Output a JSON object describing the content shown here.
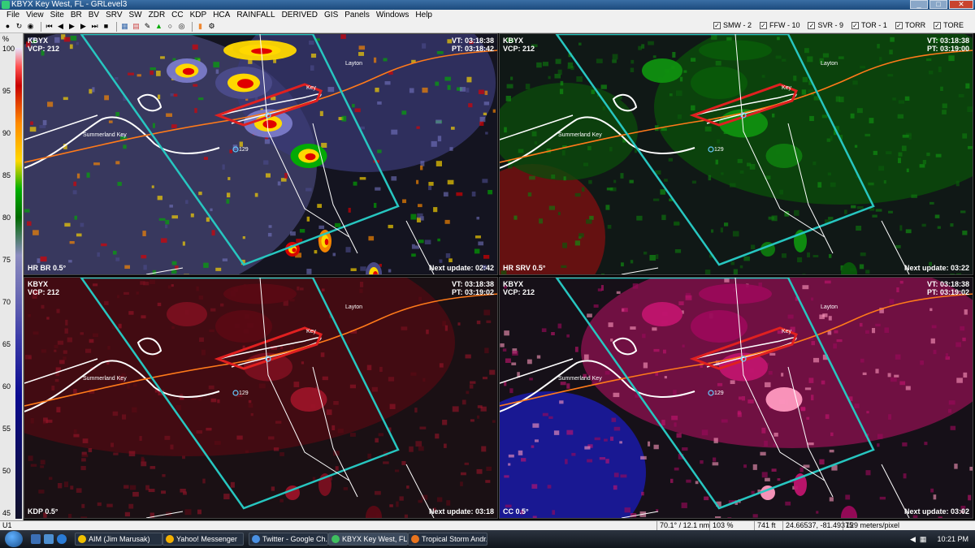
{
  "window": {
    "title": "KBYX Key West, FL - GRLevel3"
  },
  "menu": [
    "File",
    "View",
    "Site",
    "BR",
    "BV",
    "SRV",
    "SW",
    "ZDR",
    "CC",
    "KDP",
    "HCA",
    "RAINFALL",
    "DERIVED",
    "GIS",
    "Panels",
    "Windows",
    "Help"
  ],
  "toolbar": {
    "nav_icons": [
      "stop-icon",
      "refresh-icon",
      "loop-icon",
      "first-frame-icon",
      "prev-frame-icon",
      "play-icon",
      "next-frame-icon",
      "last-frame-icon",
      "pause-icon",
      "grid-icon",
      "palette-icon",
      "ruler-icon",
      "warning-icon",
      "circle-icon",
      "center-icon",
      "panel-icon",
      "settings-icon"
    ],
    "warning_toggles": [
      {
        "label": "SMW - 2",
        "checked": true
      },
      {
        "label": "FFW - 10",
        "checked": true
      },
      {
        "label": "SVR - 9",
        "checked": true
      },
      {
        "label": "TOR - 1",
        "checked": true
      },
      {
        "label": "TORR",
        "checked": true
      },
      {
        "label": "TORE",
        "checked": true
      }
    ]
  },
  "legend": {
    "unit": "%",
    "ticks": [
      "100",
      "95",
      "90",
      "85",
      "80",
      "75",
      "70",
      "65",
      "60",
      "55",
      "50",
      "45"
    ]
  },
  "panels": [
    {
      "site": "KBYX",
      "vcp": "VCP: 212",
      "vt": "VT: 03:18:38",
      "pt": "PT: 03:18:42",
      "product": "HR BR 0.5°",
      "next": "Next update: 02:42",
      "palette": "reflectivity"
    },
    {
      "site": "KBYX",
      "vcp": "VCP: 212",
      "vt": "VT: 03:18:38",
      "pt": "PT: 03:19:00",
      "product": "HR SRV 0.5°",
      "next": "Next update: 03:22",
      "palette": "velocity"
    },
    {
      "site": "KBYX",
      "vcp": "VCP: 212",
      "vt": "VT: 03:18:38",
      "pt": "PT: 03:19:02",
      "product": "KDP 0.5°",
      "next": "Next update: 03:18",
      "palette": "kdp"
    },
    {
      "site": "KBYX",
      "vcp": "VCP: 212",
      "vt": "VT: 03:18:38",
      "pt": "PT: 03:19:02",
      "product": "CC 0.5°",
      "next": "Next update: 03:02",
      "palette": "cc"
    }
  ],
  "map_labels": {
    "summerland": "Summerland Key",
    "layton": "Layton",
    "key": "Key",
    "road": "129"
  },
  "colors": {
    "warning_polygon": "#27c6c0",
    "tor_polygon": "#e02020",
    "highway": "#ff7a1a",
    "coast": "#ffffff"
  },
  "statusbar": {
    "left": "U1",
    "azimuth": "70.1° / 12.1 nm",
    "percent": "103 %",
    "height": "741 ft",
    "coords": "24.66537, -81.49375",
    "scale": "129 meters/pixel"
  },
  "taskbar": {
    "tasks": [
      {
        "label": "AIM (Jim Marusak)",
        "color": "#f0c000",
        "active": false
      },
      {
        "label": "Yahoo! Messenger",
        "color": "#f3b000",
        "active": false
      },
      {
        "label": "Twitter - Google Ch...",
        "color": "#4a90e2",
        "active": false
      },
      {
        "label": "KBYX Key West, FL -...",
        "color": "#3fbf5f",
        "active": true
      },
      {
        "label": "Tropical Storm Andr...",
        "color": "#e8741e",
        "active": false
      }
    ],
    "clock": "10:21 PM"
  }
}
